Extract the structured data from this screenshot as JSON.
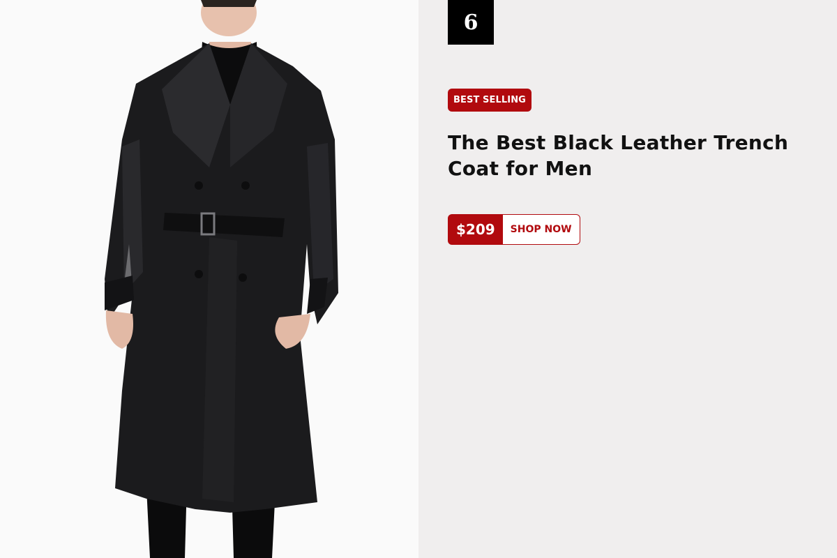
{
  "product": {
    "rank": "6",
    "badge": "BEST SELLING",
    "title": "The Best Black Leather Trench Coat for Men",
    "price": "$209",
    "cta_label": "SHOP NOW"
  },
  "colors": {
    "accent": "#b10a0e",
    "panel_bg": "#f0eeee",
    "photo_bg": "#fafafa",
    "rank_bg": "#000000"
  },
  "image": {
    "subject": "man wearing black leather trench coat"
  }
}
